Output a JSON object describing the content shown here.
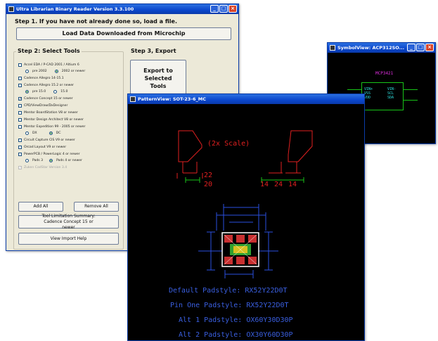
{
  "reader": {
    "title": "Ultra Librarian Binary Reader Version 3.3.100",
    "step1": "Step 1. If you have not already done so, load a file.",
    "load_button": "Load Data Downloaded from Microchip",
    "step2": "Step 2: Select Tools",
    "step3": "Step 3, Export",
    "export_button": "Export to Selected Tools",
    "tools": [
      {
        "label": "Accel EDA / P-CAD 2001 / Altium 6",
        "checked": false
      },
      {
        "label": "Cadence Allegro 14-15.1",
        "checked": false
      },
      {
        "label": "Cadence Allegro 15.2 or newer",
        "checked": false
      },
      {
        "label": "Cadence Concept 15 or newer",
        "checked": true
      },
      {
        "label": "CPD/ViewDraw/DxDesigner",
        "checked": false
      },
      {
        "label": "Mentor BoardStation V8 or newer",
        "checked": false
      },
      {
        "label": "Mentor Design Architect V8 or newer",
        "checked": false
      },
      {
        "label": "Mentor Expedition 99 - 2005 or newer",
        "checked": false
      },
      {
        "label": "Circuit Capture CIS V9 or newer",
        "checked": false
      },
      {
        "label": "Orcad Layout V9 or newer",
        "checked": false
      },
      {
        "label": "PowerPCB / PowerLogic 4 or newer",
        "checked": false
      },
      {
        "label": "Zuken CadStar Version 3.4",
        "checked": false,
        "disabled": true
      }
    ],
    "sub_accel": [
      "pre 2002",
      "2002 or newer"
    ],
    "sub_allegro": [
      "pre 15.0",
      "15.0"
    ],
    "sub_mentor": [
      "DX",
      "DC"
    ],
    "sub_pads": [
      "Pads 3",
      "Pads 4 or newer"
    ],
    "add_all": "Add All",
    "remove_all": "Remove All",
    "tool_limitation": "Tool Limitation Summary: Cadence Concept 15 or newer",
    "view_help": "View Import Help"
  },
  "symbol": {
    "title": "SymbolView: ACP312SO...",
    "part_name": "MCP3421",
    "pins_left": [
      "VIN+",
      "VSS",
      "VDD"
    ],
    "pins_right": [
      "VIN-",
      "SCL",
      "SDA"
    ]
  },
  "pattern": {
    "title": "PatternView: SOT-23-6_MC",
    "scale_label": "(2x Scale)",
    "dim_left": [
      "22",
      "20"
    ],
    "dim_right": [
      "14",
      "24",
      "14"
    ],
    "info_lines": [
      "Default Padstyle: RX52Y22D0T",
      "Pin One Padstyle: RX52Y22D0T",
      "Alt 1 Padstyle: OX60Y30D30P",
      "Alt 2 Padstyle: OX30Y60D30P"
    ]
  }
}
